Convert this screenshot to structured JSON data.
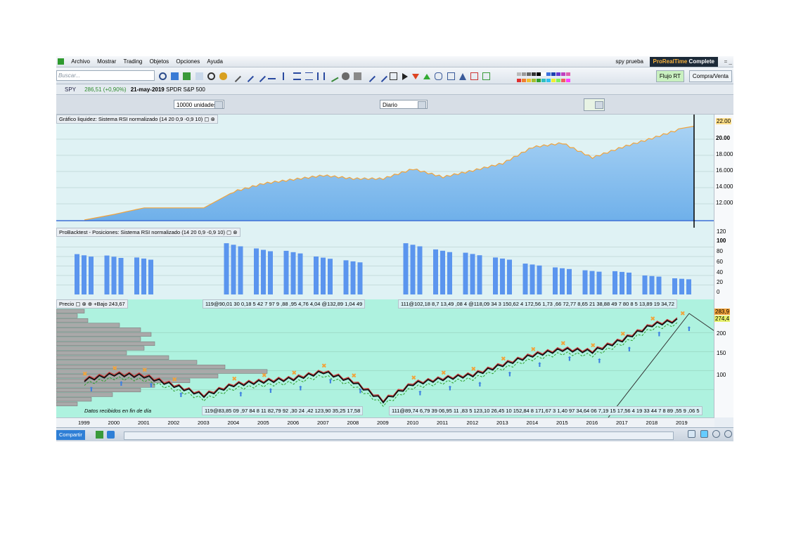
{
  "menu": {
    "items": [
      "Archivo",
      "Mostrar",
      "Trading",
      "Objetos",
      "Opciones",
      "Ayuda"
    ],
    "user": "spy prueba",
    "brand_a": "ProRealTime",
    "brand_b": "Complete"
  },
  "toolbar": {
    "search_placeholder": "Buscar...",
    "flujo_label": "Flujo RT",
    "compra_label": "Compra/Venta",
    "accent_color": "#f2a33a"
  },
  "instrument": {
    "symbol": "SPY",
    "price": "286,51 (+0,90%)",
    "date": "21-may-2019",
    "name": "SPDR S&P 500"
  },
  "selectors": {
    "units": "10000 unidades",
    "period": "Diario"
  },
  "panel1": {
    "title": "Gráfico liquidez: Sistema RSI normalizado (14 20 0,9 -0,9 10)",
    "axis_labels": [
      "22.00",
      "20.00",
      "18.000",
      "16.000",
      "14.000",
      "12.000"
    ],
    "fill_color": "#8ec3ee",
    "line_color": "#f2a33a"
  },
  "panel2": {
    "title": "ProBacktest - Posiciones: Sistema RSI normalizado (14 20 0,9 -0,9 10)",
    "axis_labels": [
      "120",
      "100",
      "80",
      "60",
      "40",
      "20",
      "0"
    ],
    "bar_color": "#5b95ee"
  },
  "panel3": {
    "title": "Precio",
    "low_text": "+Bajo 243,67",
    "stats": [
      "119@90,01 30 0,18 5 42 7 97 9 ,88 ,95 4,76 4,04 @132,89 1,04 49",
      "111@102,18 8,7 13,49 ,08 4 @118,09 34 3 150,62 4 172,56 1,73 ,66 72,77 8,65 21 38,88 49 7 80 8 5 13,89 19 34,72"
    ],
    "bottom_stats": [
      "119@83,85 09 ,97 84 8 11 82,79 92 ,30 24 ,42 123,90 35,25 17,58",
      "111@89,74 6,79 39 06,95 11 ,83 5 123,10 26,45 10 152,84 8 171,67 3 1,40 97 34,64 06 7,19 15 17,56 4 19 33 44 7 8 89 ,55 9 ,06 5"
    ],
    "footer_note": "Datos recibidos en fin de día",
    "price_tags": [
      "283,9",
      "274,4"
    ],
    "axis_labels": [
      "200",
      "150",
      "100"
    ],
    "years": [
      "1999",
      "2000",
      "2001",
      "2002",
      "2003",
      "2004",
      "2005",
      "2006",
      "2007",
      "2008",
      "2009",
      "2010",
      "2011",
      "2012",
      "2013",
      "2014",
      "2015",
      "2016",
      "2017",
      "2018",
      "2019"
    ]
  },
  "bottom": {
    "share_label": "Compartir"
  },
  "chart_data": [
    {
      "type": "area",
      "title": "Gráfico liquidez: Sistema RSI normalizado (14 20 0,9 -0,9 10)",
      "x": [
        1999,
        2000,
        2001,
        2002,
        2003,
        2004,
        2005,
        2006,
        2007,
        2008,
        2009,
        2010,
        2011,
        2012,
        2013,
        2014,
        2015,
        2016,
        2017,
        2018,
        2019
      ],
      "values": [
        10.5,
        11.2,
        12.0,
        12.0,
        12.0,
        14.0,
        15.0,
        15.5,
        16.0,
        15.6,
        15.6,
        16.8,
        15.8,
        16.6,
        17.5,
        19.5,
        20.0,
        18.2,
        19.5,
        20.6,
        21.8
      ],
      "ylim": [
        10.5,
        22.5
      ]
    },
    {
      "type": "bar",
      "title": "ProBacktest - Posiciones: Sistema RSI normalizado (14 20 0,9 -0,9 10)",
      "x": [
        1999,
        2000,
        2001,
        2002,
        2003,
        2004,
        2005,
        2006,
        2007,
        2008,
        2009,
        2010,
        2011,
        2012,
        2013,
        2014,
        2015,
        2016,
        2017,
        2018,
        2019
      ],
      "values": [
        85,
        82,
        78,
        0,
        0,
        108,
        97,
        92,
        80,
        72,
        0,
        108,
        95,
        88,
        78,
        65,
        57,
        51,
        49,
        40,
        34
      ],
      "ylim": [
        0,
        120
      ]
    },
    {
      "type": "line",
      "title": "Precio",
      "x": [
        1999,
        2000,
        2001,
        2002,
        2003,
        2004,
        2005,
        2006,
        2007,
        2008,
        2009,
        2010,
        2011,
        2012,
        2013,
        2014,
        2015,
        2016,
        2017,
        2018,
        2019
      ],
      "values": [
        125,
        140,
        135,
        110,
        84,
        112,
        121,
        128,
        146,
        120,
        70,
        115,
        128,
        138,
        165,
        190,
        205,
        200,
        230,
        270,
        284
      ],
      "ylim": [
        60,
        310
      ]
    }
  ]
}
